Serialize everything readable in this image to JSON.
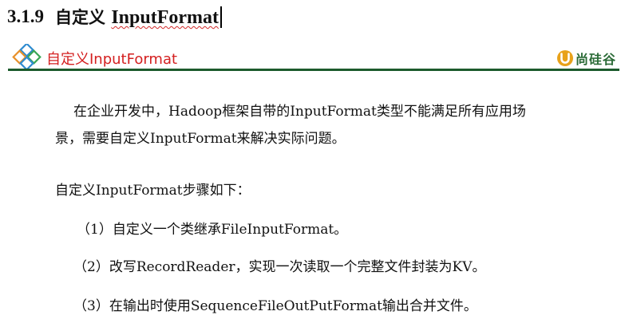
{
  "heading": {
    "number": "3.1.9",
    "prefix": "自定义",
    "name": "InputFormat"
  },
  "banner": {
    "title": "自定义InputFormat",
    "brand": "尚硅谷",
    "accent_color": "#d42020",
    "rule_color": "#1c5a2c",
    "logo_colors": [
      "#2e8bd0",
      "#e8902a",
      "#3aa655"
    ]
  },
  "content": {
    "paragraph_line1": "在企业开发中，Hadoop框架自带的InputFormat类型不能满足所有应用场",
    "paragraph_line2": "景，需要自定义InputFormat来解决实际问题。",
    "steps_intro": "自定义InputFormat步骤如下：",
    "steps": [
      "（1）自定义一个类继承FileInputFormat。",
      "（2）改写RecordReader，实现一次读取一个完整文件封装为KV。",
      "（3）在输出时使用SequenceFileOutPutFormat输出合并文件。"
    ]
  }
}
